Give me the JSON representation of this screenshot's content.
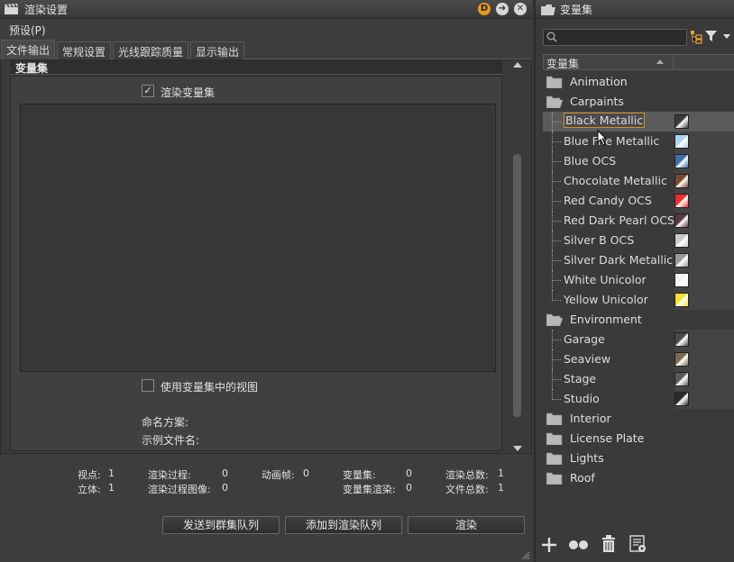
{
  "render_window": {
    "title": "渲染设置",
    "window_buttons": {
      "d": "D",
      "arrow": "➜",
      "close": "✕"
    },
    "menu": {
      "presets": "预设(P)"
    },
    "tabs": [
      "文件输出",
      "常规设置",
      "光线跟踪质量",
      "显示输出"
    ],
    "section": {
      "title": "变量集",
      "render_variant_sets_label": "渲染变量集",
      "render_variant_sets_checked": true,
      "use_views_label": "使用变量集中的视图",
      "use_views_checked": false,
      "naming_scheme_label": "命名方案:",
      "example_filename_label": "示例文件名:"
    },
    "stats": {
      "viewpoints_label": "视点:",
      "viewpoints": "1",
      "stereo_label": "立体:",
      "stereo": "1",
      "render_passes_label": "渲染过程:",
      "render_passes": "0",
      "render_pass_images_label": "渲染过程图像:",
      "render_pass_images": "0",
      "anim_frames_label": "动画帧:",
      "anim_frames": "0",
      "variant_sets_label": "变量集:",
      "variant_sets": "0",
      "variant_set_renders_label": "变量集渲染:",
      "variant_set_renders": "0",
      "render_total_label": "渲染总数:",
      "render_total": "1",
      "file_total_label": "文件总数:",
      "file_total": "1"
    },
    "buttons": {
      "send_cluster": "发送到群集队列",
      "add_queue": "添加到渲染队列",
      "render": "渲染"
    }
  },
  "variant_panel": {
    "title": "变量集",
    "search_placeholder": "",
    "column_header": "变量集",
    "tree": [
      {
        "type": "folder",
        "label": "Animation",
        "open": false
      },
      {
        "type": "folder",
        "label": "Carpaints",
        "open": true
      },
      {
        "type": "item",
        "label": "Black Metallic",
        "swatch": "#3a3a3a",
        "selected": true
      },
      {
        "type": "item",
        "label": "Blue Fire Metallic",
        "swatch": "#a8d4f0"
      },
      {
        "type": "item",
        "label": "Blue OCS",
        "swatch": "#3c6fa8"
      },
      {
        "type": "item",
        "label": "Chocolate Metallic",
        "swatch": "#7a4a2e"
      },
      {
        "type": "item",
        "label": "Red Candy OCS",
        "swatch": "#e8302a"
      },
      {
        "type": "item",
        "label": "Red Dark Pearl OCS",
        "swatch": "#5a3a40"
      },
      {
        "type": "item",
        "label": "Silver B OCS",
        "swatch": "#c8c8c8"
      },
      {
        "type": "item",
        "label": "Silver Dark Metallic",
        "swatch": "#9a9a9a"
      },
      {
        "type": "item",
        "label": "White Unicolor",
        "swatch": "#f2f2f2"
      },
      {
        "type": "item",
        "label": "Yellow Unicolor",
        "swatch": "#f5e030",
        "last": true
      },
      {
        "type": "folder",
        "label": "Environment",
        "open": true
      },
      {
        "type": "item",
        "label": "Garage",
        "swatch": "#4a4a4a"
      },
      {
        "type": "item",
        "label": "Seaview",
        "swatch": "#7a6a50"
      },
      {
        "type": "item",
        "label": "Stage",
        "swatch": "#5a5a5a"
      },
      {
        "type": "item",
        "label": "Studio",
        "swatch": "#2a2a2a",
        "last": true
      },
      {
        "type": "folder",
        "label": "Interior",
        "open": false
      },
      {
        "type": "folder",
        "label": "License Plate",
        "open": false
      },
      {
        "type": "folder",
        "label": "Lights",
        "open": false
      },
      {
        "type": "folder",
        "label": "Roof",
        "open": false
      }
    ]
  },
  "colors": {
    "accent_orange": "#e89a1c",
    "selection_border": "#d88a2a"
  }
}
